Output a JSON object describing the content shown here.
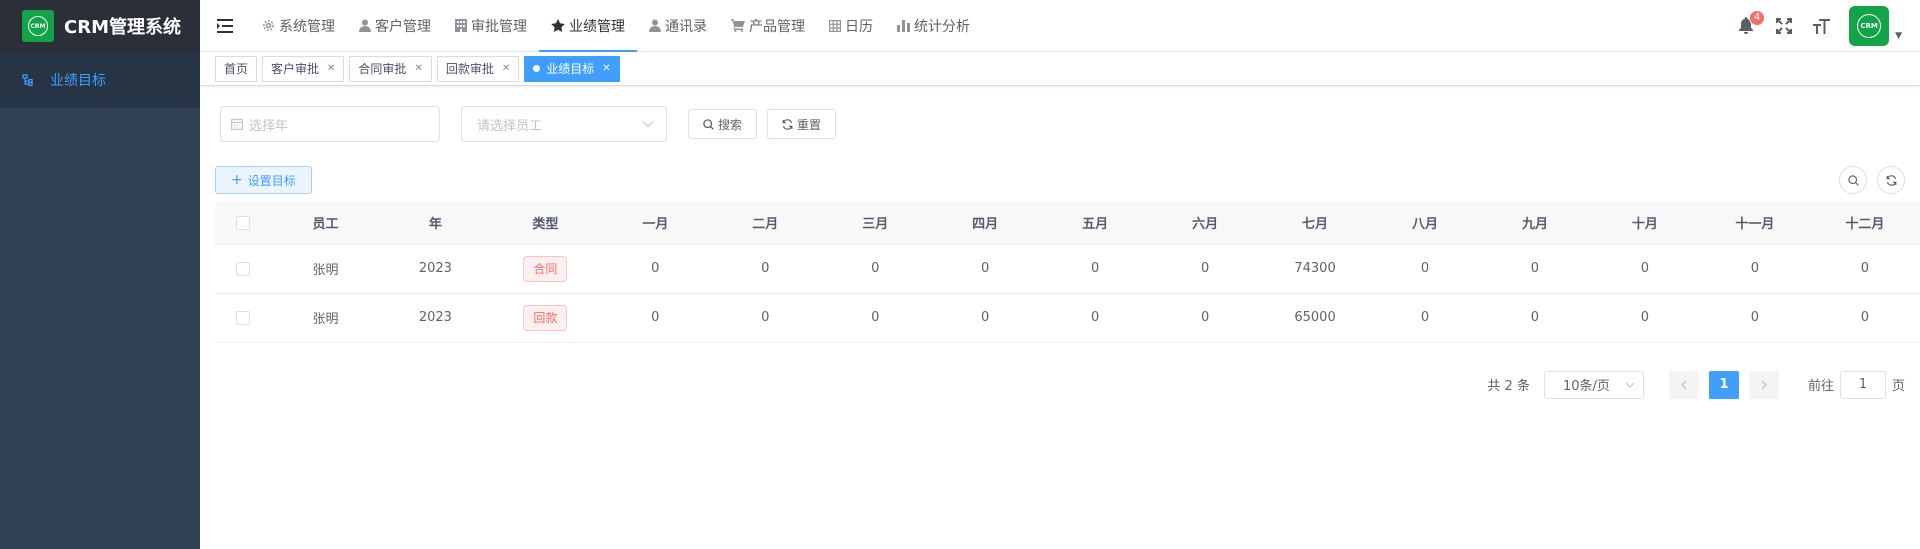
{
  "app": {
    "title": "CRM管理系统",
    "logo_text": "CRM"
  },
  "sidebar": {
    "items": [
      {
        "label": "业绩目标"
      }
    ]
  },
  "header": {
    "nav": [
      {
        "label": "系统管理",
        "icon": "gear-icon"
      },
      {
        "label": "客户管理",
        "icon": "user-icon"
      },
      {
        "label": "审批管理",
        "icon": "building-icon"
      },
      {
        "label": "业绩管理",
        "icon": "star-icon",
        "active": true
      },
      {
        "label": "通讯录",
        "icon": "user-icon"
      },
      {
        "label": "产品管理",
        "icon": "cart-icon"
      },
      {
        "label": "日历",
        "icon": "calendar-grid-icon"
      },
      {
        "label": "统计分析",
        "icon": "bar-chart-icon"
      }
    ],
    "notification_count": "4",
    "avatar_text": "CRM"
  },
  "tags": [
    {
      "label": "首页",
      "closable": false
    },
    {
      "label": "客户审批",
      "closable": true
    },
    {
      "label": "合同审批",
      "closable": true
    },
    {
      "label": "回款审批",
      "closable": true
    },
    {
      "label": "业绩目标",
      "closable": true,
      "active": true
    }
  ],
  "filters": {
    "year_placeholder": "选择年",
    "employee_placeholder": "请选择员工",
    "search_label": "搜索",
    "reset_label": "重置"
  },
  "toolbar": {
    "add_label": "设置目标"
  },
  "table": {
    "headers": [
      "员工",
      "年",
      "类型",
      "一月",
      "二月",
      "三月",
      "四月",
      "五月",
      "六月",
      "七月",
      "八月",
      "九月",
      "十月",
      "十一月",
      "十二月"
    ],
    "rows": [
      {
        "employee": "张明",
        "year": "2023",
        "type": "合同",
        "months": [
          "0",
          "0",
          "0",
          "0",
          "0",
          "0",
          "74300",
          "0",
          "0",
          "0",
          "0",
          "0"
        ]
      },
      {
        "employee": "张明",
        "year": "2023",
        "type": "回款",
        "months": [
          "0",
          "0",
          "0",
          "0",
          "0",
          "0",
          "65000",
          "0",
          "0",
          "0",
          "0",
          "0"
        ]
      }
    ]
  },
  "pagination": {
    "total_text": "共 2 条",
    "page_size": "10条/页",
    "current_page": "1",
    "goto_label": "前往",
    "goto_value": "1",
    "page_suffix": "页"
  },
  "colors": {
    "primary": "#409eff",
    "sidebar_bg": "#304156",
    "logo_green": "#13a44a",
    "danger": "#f56c6c"
  }
}
